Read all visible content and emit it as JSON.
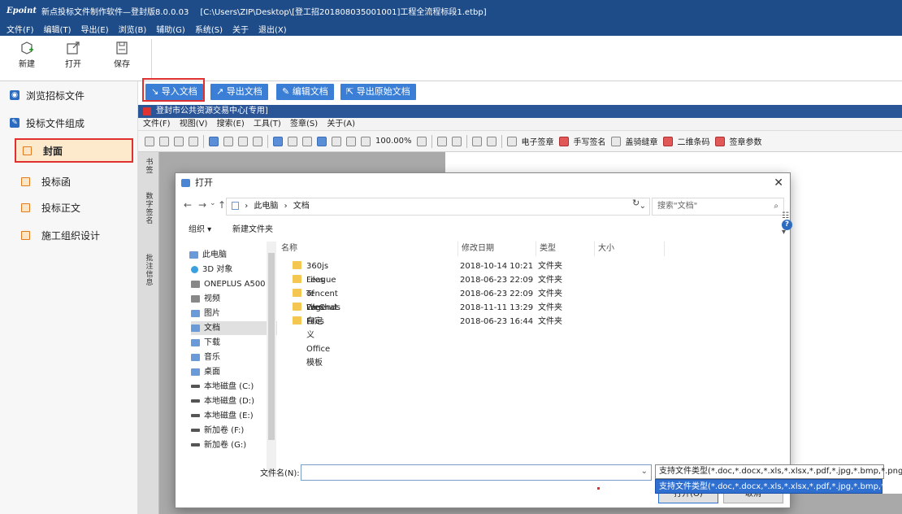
{
  "titlebar": {
    "logo": "Epoint",
    "app": "新点投标文件制作软件—登封版8.0.0.03",
    "path": "[C:\\Users\\ZIP\\Desktop\\[登工招201808035001001]工程全流程标段1.etbp]"
  },
  "menubar": [
    "文件(F)",
    "编辑(T)",
    "导出(E)",
    "浏览(B)",
    "辅助(G)",
    "系统(S)",
    "关于",
    "退出(X)"
  ],
  "toolbar": {
    "new_label": "新建",
    "open_label": "打开",
    "save_label": "保存"
  },
  "sidebar": {
    "browse_label": "浏览招标文件",
    "compose_label": "投标文件组成",
    "items": [
      {
        "label": "封面"
      },
      {
        "label": "投标函"
      },
      {
        "label": "投标正文"
      },
      {
        "label": "施工组织设计"
      }
    ]
  },
  "actions": {
    "import": "导入文档",
    "export": "导出文档",
    "edit": "编辑文档",
    "export_original": "导出原始文档"
  },
  "doc": {
    "title": "登封市公共资源交易中心[专用]",
    "menu": [
      "文件(F)",
      "视图(V)",
      "搜索(E)",
      "工具(T)",
      "签章(S)",
      "关于(A)"
    ],
    "zoom": "100.00%",
    "sign_tools": [
      "电子签章",
      "手写签名",
      "盖骑缝章",
      "二维条码",
      "签章参数"
    ],
    "vstrip": [
      "书签",
      "数字签名",
      "批注信息"
    ]
  },
  "dialog": {
    "title": "打开",
    "breadcrumb": [
      "此电脑",
      "文档"
    ],
    "search_placeholder": "搜索\"文档\"",
    "organize": "组织 ▾",
    "new_folder": "新建文件夹",
    "nav": [
      "此电脑",
      "3D 对象",
      "ONEPLUS A500",
      "视频",
      "图片",
      "文档",
      "下载",
      "音乐",
      "桌面",
      "本地磁盘 (C:)",
      "本地磁盘 (D:)",
      "本地磁盘 (E:)",
      "新加卷 (F:)",
      "新加卷 (G:)"
    ],
    "columns": {
      "name": "名称",
      "date": "修改日期",
      "type": "类型",
      "size": "大小"
    },
    "files": [
      {
        "name": "360js Files",
        "date": "2018-10-14 10:21",
        "type": "文件夹"
      },
      {
        "name": "League of Legends",
        "date": "2018-06-23 22:09",
        "type": "文件夹"
      },
      {
        "name": "Tencent Files",
        "date": "2018-06-23 22:09",
        "type": "文件夹"
      },
      {
        "name": "WeChat Files",
        "date": "2018-11-11 13:29",
        "type": "文件夹"
      },
      {
        "name": "自定义 Office 模板",
        "date": "2018-06-23 16:44",
        "type": "文件夹"
      }
    ],
    "filename_label": "文件名(N):",
    "filename_value": "",
    "filetype": "支持文件类型(*.doc,*.docx,*.xls,*.xlsx,*.pdf,*.jpg,*.bmp,*.png)",
    "filetype_option": "支持文件类型(*.doc,*.docx,*.xls,*.xlsx,*.pdf,*.jpg,*.bmp,*.png)",
    "open_label": "打开(O)",
    "cancel_label": "取消"
  }
}
